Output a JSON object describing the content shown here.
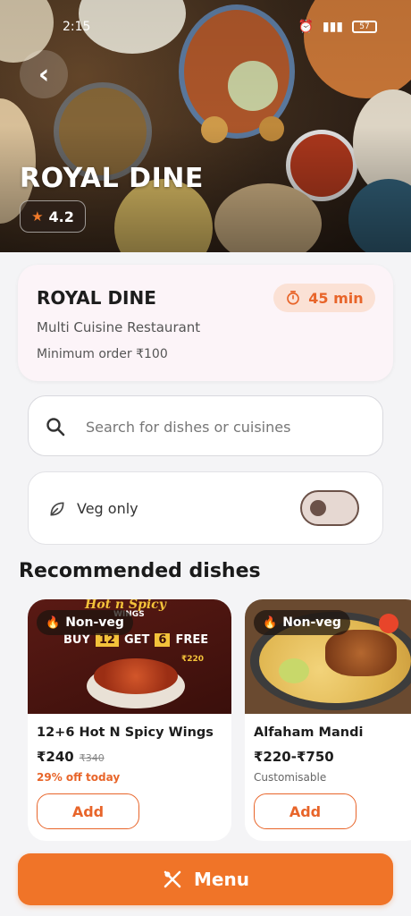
{
  "status_bar": {
    "time": "2:15",
    "battery": "57"
  },
  "hero": {
    "title": "ROYAL DINE",
    "rating": "4.2"
  },
  "info": {
    "name": "ROYAL DINE",
    "delivery_time": "45 min",
    "cuisine": "Multi Cuisine Restaurant",
    "minimum_order": "Minimum order ₹100"
  },
  "search": {
    "placeholder": "Search for dishes or cuisines"
  },
  "veg_filter": {
    "label": "Veg only",
    "enabled": false
  },
  "recommended": {
    "title": "Recommended dishes",
    "dishes": [
      {
        "badge": "Non-veg",
        "name": "12+6 Hot N Spicy Wings",
        "price": "₹240",
        "old_price": "₹340",
        "note": "29% off today",
        "add_label": "Add",
        "image_text": {
          "headline": "Hot n Spicy",
          "sub": "WINGS",
          "offer_buy": "BUY",
          "buy_qty": "12",
          "offer_get": "GET",
          "get_qty": "6",
          "offer_free": "FREE",
          "price_tag": "₹220"
        }
      },
      {
        "badge": "Non-veg",
        "name": "Alfaham Mandi",
        "price": "₹220-₹750",
        "note": "Customisable",
        "add_label": "Add"
      }
    ]
  },
  "menu_button": {
    "label": "Menu"
  },
  "colors": {
    "accent": "#f07428",
    "accent_text": "#e8652a",
    "card_bg": "#fcf4f8"
  }
}
